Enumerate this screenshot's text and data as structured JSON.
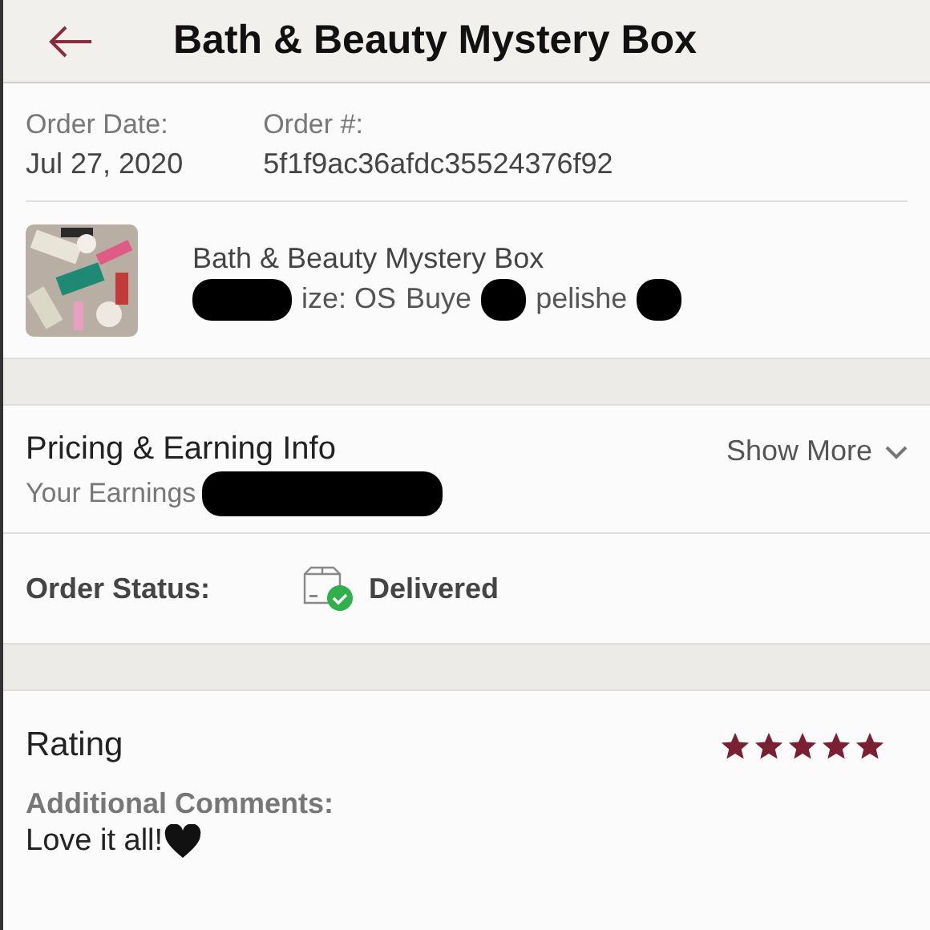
{
  "header": {
    "title": "Bath & Beauty Mystery Box"
  },
  "order": {
    "date_label": "Order Date:",
    "date": "Jul 27, 2020",
    "number_label": "Order #:",
    "number": "5f1f9ac36afdc35524376f92"
  },
  "item": {
    "kind": "picture",
    "title": "Bath & Beauty Mystery Box",
    "meta": [
      "ize: OS",
      "Buye",
      "pelishe"
    ]
  },
  "pricing": {
    "title": "Pricing & Earning Info",
    "earnings": "Your Earnings",
    "action": "Show More"
  },
  "status": {
    "label": "Order Status:",
    "value": "Delivered",
    "delivered": true
  },
  "rating": {
    "title": "Rating",
    "stars": 5,
    "comments_label": "Additional Comments:",
    "comment": "Love it all!"
  }
}
